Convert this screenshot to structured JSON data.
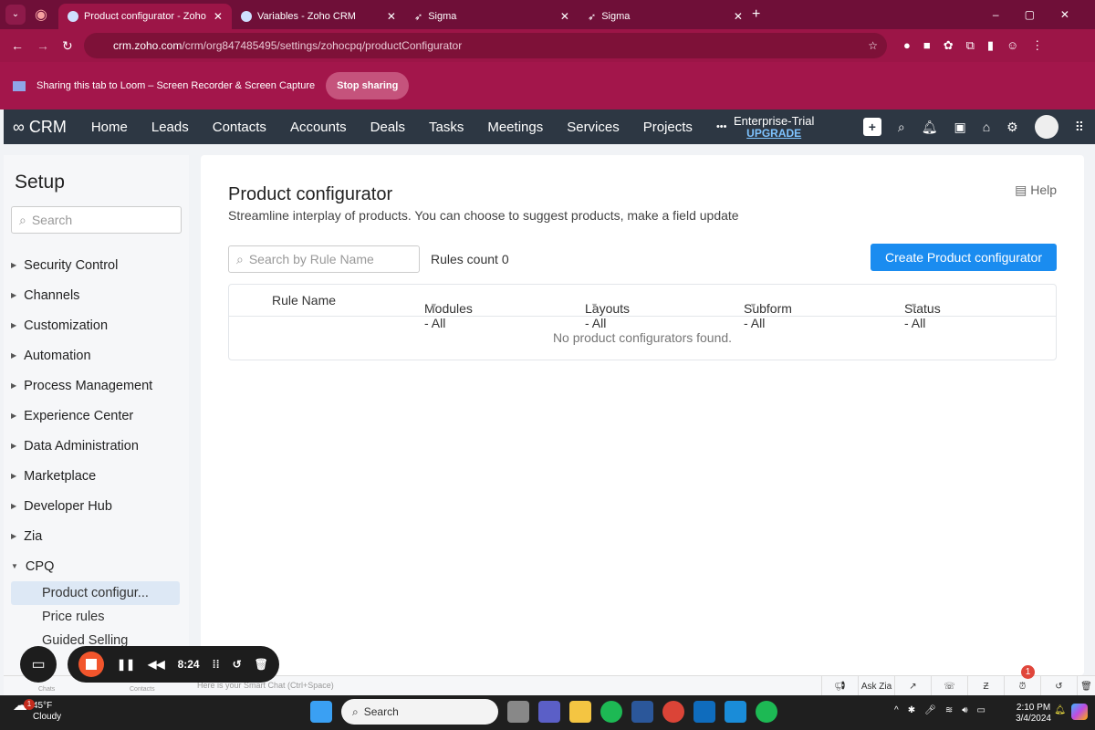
{
  "browser": {
    "tabs": [
      {
        "label": "Product configurator - Zoho",
        "active": true
      },
      {
        "label": "Variables - Zoho CRM"
      },
      {
        "label": "Sigma"
      },
      {
        "label": "Sigma"
      }
    ],
    "url_host": "crm.zoho.com",
    "url_path": "/crm/org847485495/settings/zohocpq/productConfigurator"
  },
  "loom": {
    "message": "Sharing this tab to Loom – Screen Recorder & Screen Capture",
    "stop_label": "Stop sharing",
    "timer": "8:24"
  },
  "crm": {
    "logo": "CRM",
    "nav": [
      "Home",
      "Leads",
      "Contacts",
      "Accounts",
      "Deals",
      "Tasks",
      "Meetings",
      "Services",
      "Projects",
      "•••"
    ],
    "plan": "Enterprise-Trial",
    "upgrade": "UPGRADE"
  },
  "sidebar": {
    "title": "Setup",
    "search_placeholder": "Search",
    "items": [
      "Security Control",
      "Channels",
      "Customization",
      "Automation",
      "Process Management",
      "Experience Center",
      "Data Administration",
      "Marketplace",
      "Developer Hub",
      "Zia"
    ],
    "expanded": "CPQ",
    "sub_items": [
      "Product configur...",
      "Price rules",
      "Guided Selling"
    ]
  },
  "main": {
    "title": "Product configurator",
    "subtitle": "Streamline interplay of products. You can choose to suggest products, make a field update",
    "help": "Help",
    "search_placeholder": "Search by Rule Name",
    "rules_count": "Rules count 0",
    "create_label": "Create Product configurator",
    "columns": [
      "Rule Name",
      "Modules - All",
      "Layouts - All",
      "Subform - All",
      "Status - All"
    ],
    "empty": "No product configurators found."
  },
  "chatbar": {
    "placeholder": "Here is your Smart Chat (Ctrl+Space)",
    "chats": "Chats",
    "contacts": "Contacts",
    "ask_zia": "Ask Zia",
    "badge": "1"
  },
  "taskbar": {
    "temp": "45°F",
    "weather": "Cloudy",
    "weather_badge": "1",
    "search": "Search",
    "time": "2:10 PM",
    "date": "3/4/2024"
  }
}
